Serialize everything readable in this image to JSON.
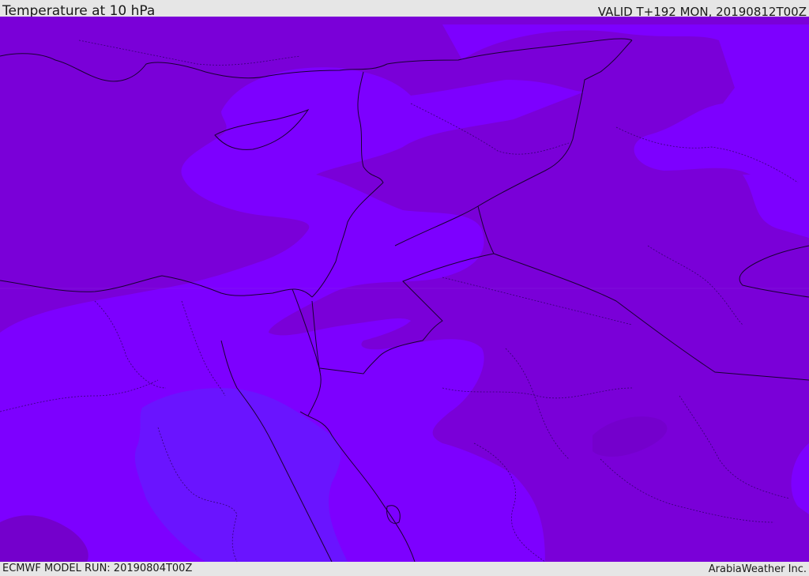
{
  "header": {
    "title": "Temperature at 10 hPa",
    "valid_time": "VALID T+192 MON, 20190812T00Z"
  },
  "footer": {
    "model_run": "ECMWF MODEL RUN: 20190804T00Z",
    "provider": "ArabiaWeather Inc."
  },
  "colors": {
    "band_cold": "#7a00d8",
    "band_mid": "#7d00ff",
    "band_warm": "#6a14ff",
    "band_deep": "#7400cc",
    "coastline": "#1a0033",
    "border_dotted": "#2a0060",
    "background": "#e6e6e6"
  }
}
